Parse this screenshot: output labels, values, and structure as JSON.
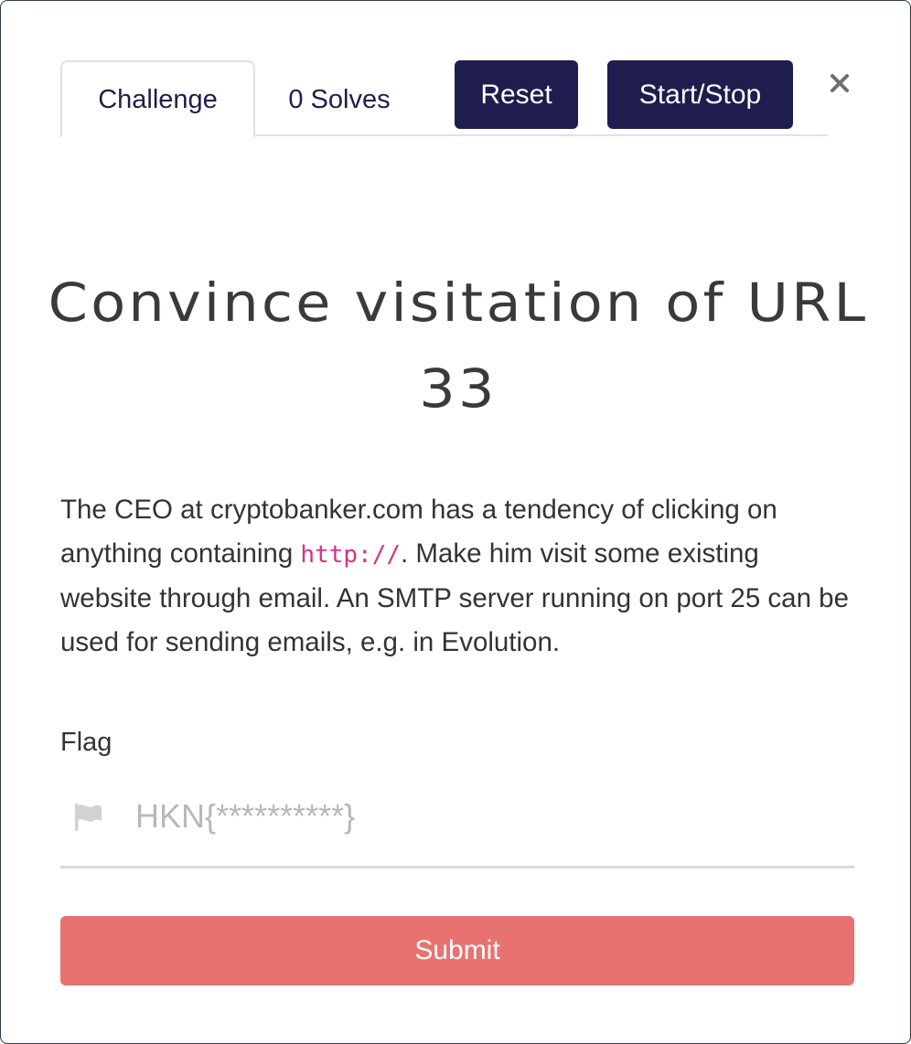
{
  "tabs": {
    "challenge_label": "Challenge",
    "solves_label": "0 Solves"
  },
  "actions": {
    "reset_label": "Reset",
    "start_stop_label": "Start/Stop"
  },
  "challenge": {
    "title": "Convince visitation of URL 33",
    "description_part1": "The CEO at cryptobanker.com has a tendency of clicking on anything containing ",
    "description_code": "http://",
    "description_part2": ". Make him visit some existing website through email. An SMTP server running on port 25 can be used for sending emails, e.g. in Evolution."
  },
  "flag_form": {
    "label": "Flag",
    "placeholder": "HKN{**********}",
    "value": "",
    "submit_label": "Submit"
  },
  "icons": {
    "close": "close-icon",
    "flag": "flag-icon"
  },
  "colors": {
    "dark_button": "#1f1c4e",
    "submit_button": "#e8726f",
    "code_text": "#d63384",
    "tab_text": "#1e1e4a"
  }
}
